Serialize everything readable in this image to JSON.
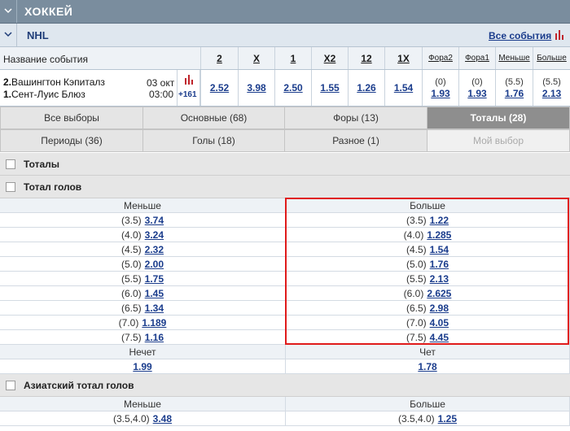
{
  "sport": {
    "title": "ХОККЕЙ"
  },
  "league": {
    "title": "NHL",
    "all_events": "Все события"
  },
  "header": {
    "event_name_label": "Название события",
    "columns": [
      "2",
      "X",
      "1",
      "X2",
      "12",
      "1X",
      "Фора2",
      "Фора1",
      "Меньше",
      "Больше"
    ]
  },
  "event": {
    "team1_num": "2.",
    "team1": "Вашингтон Кэпиталз",
    "team2_num": "1.",
    "team2": "Сент-Луис Блюз",
    "date": "03 окт",
    "time": "03:00",
    "more": "+161",
    "odds": [
      "2.52",
      "3.98",
      "2.50",
      "1.55",
      "1.26",
      "1.54"
    ],
    "fora2": {
      "param": "(0)",
      "value": "1.93"
    },
    "fora1": {
      "param": "(0)",
      "value": "1.93"
    },
    "under": {
      "param": "(5.5)",
      "value": "1.76"
    },
    "over": {
      "param": "(5.5)",
      "value": "2.13"
    }
  },
  "tabs": [
    {
      "label": "Все выборы"
    },
    {
      "label": "Основные (68)"
    },
    {
      "label": "Форы (13)"
    },
    {
      "label": "Тоталы (28)"
    },
    {
      "label": "Периоды (36)"
    },
    {
      "label": "Голы (18)"
    },
    {
      "label": "Разное (1)"
    },
    {
      "label": "Мой выбор"
    }
  ],
  "sections": {
    "totals": "Тоталы",
    "total_goals": "Тотал голов",
    "asian_total": "Азиатский тотал голов"
  },
  "total_goals": {
    "under_label": "Меньше",
    "over_label": "Больше",
    "rows": [
      {
        "under_p": "(3.5)",
        "under_v": "3.74",
        "over_p": "(3.5)",
        "over_v": "1.22"
      },
      {
        "under_p": "(4.0)",
        "under_v": "3.24",
        "over_p": "(4.0)",
        "over_v": "1.285"
      },
      {
        "under_p": "(4.5)",
        "under_v": "2.32",
        "over_p": "(4.5)",
        "over_v": "1.54"
      },
      {
        "under_p": "(5.0)",
        "under_v": "2.00",
        "over_p": "(5.0)",
        "over_v": "1.76"
      },
      {
        "under_p": "(5.5)",
        "under_v": "1.75",
        "over_p": "(5.5)",
        "over_v": "2.13"
      },
      {
        "under_p": "(6.0)",
        "under_v": "1.45",
        "over_p": "(6.0)",
        "over_v": "2.625"
      },
      {
        "under_p": "(6.5)",
        "under_v": "1.34",
        "over_p": "(6.5)",
        "over_v": "2.98"
      },
      {
        "under_p": "(7.0)",
        "under_v": "1.189",
        "over_p": "(7.0)",
        "over_v": "4.05"
      },
      {
        "under_p": "(7.5)",
        "under_v": "1.16",
        "over_p": "(7.5)",
        "over_v": "4.45"
      }
    ],
    "odd_label": "Нечет",
    "even_label": "Чет",
    "odd_value": "1.99",
    "even_value": "1.78"
  },
  "asian_total": {
    "under_label": "Меньше",
    "over_label": "Больше",
    "rows": [
      {
        "under_p": "(3.5,4.0)",
        "under_v": "3.48",
        "over_p": "(3.5,4.0)",
        "over_v": "1.25"
      }
    ]
  },
  "colors": {
    "link": "#1a3c8c",
    "sport_bar": "#7a8d9e",
    "active_tab": "#8e8e8e",
    "highlight": "#e01b1b"
  }
}
